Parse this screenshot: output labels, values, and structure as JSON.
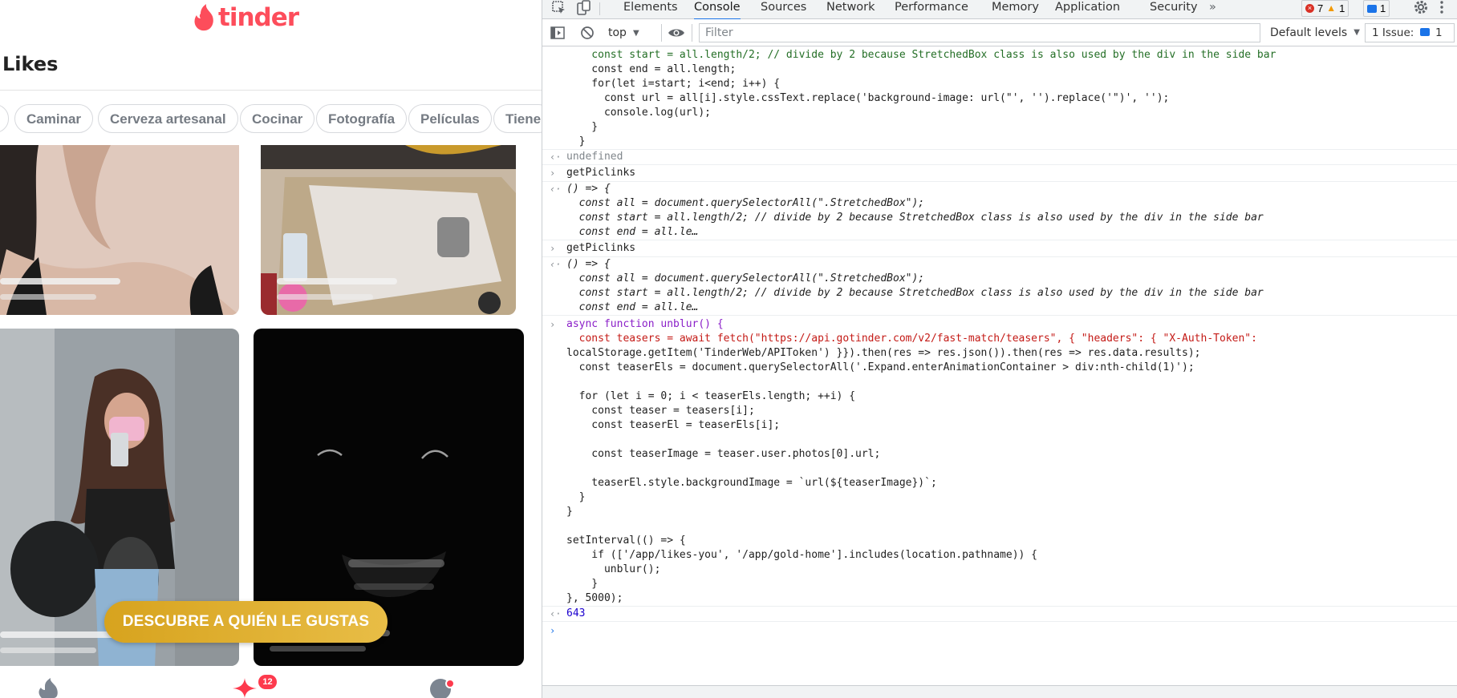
{
  "tinder": {
    "logo_text": "tinder",
    "page_title": "Likes",
    "interests": [
      "Caminar",
      "Cerveza artesanal",
      "Cocinar",
      "Fotografía",
      "Películas",
      "Tiene"
    ],
    "cta_label": "DESCUBRE A QUIÉN LE GUSTAS",
    "notification_count": "12",
    "brand_color": "#fd4d5b",
    "cta_color": "#e0ae30",
    "nav_icons": [
      "flame-icon",
      "sparkle-icon",
      "chat-icon"
    ]
  },
  "devtools": {
    "tabs": [
      "Elements",
      "Console",
      "Sources",
      "Network",
      "Performance",
      "Memory",
      "Application",
      "Security"
    ],
    "active_tab": "Console",
    "more_tabs": "»",
    "error_count": "7",
    "warning_count": "1",
    "message_count": "1",
    "context": "top",
    "filter_placeholder": "Filter",
    "levels": "Default levels",
    "issues_label": "1 Issue:",
    "issues_count": "1",
    "console_lines": {
      "l1": "    const start = all.length/2; // divide by 2 because StretchedBox class is also used by the div in the side bar",
      "l2": "    const end = all.length;",
      "l3": "    for(let i=start; i<end; i++) {",
      "l4": "      const url = all[i].style.cssText.replace('background-image: url(\"', '').replace('\")', '');",
      "l5": "      console.log(url);",
      "l6": "    }",
      "l7": "  }",
      "undefined": "undefined",
      "getpic": "getPiclinks",
      "arrow_fn": "() => {",
      "qs_all": "  const all = document.querySelectorAll(\".StretchedBox\");",
      "qs_start": "  const start = all.length/2; // divide by 2 because StretchedBox class is also used by the div in the side bar",
      "qs_end": "  const end = all.le…",
      "u1": "async function unblur() {",
      "u2": "  const teasers = await fetch(\"https://api.gotinder.com/v2/fast-match/teasers\", { \"headers\": { \"X-Auth-Token\":",
      "u3": "localStorage.getItem('TinderWeb/APIToken') }}).then(res => res.json()).then(res => res.data.results);",
      "u4": "  const teaserEls = document.querySelectorAll('.Expand.enterAnimationContainer > div:nth-child(1)');",
      "u5": "",
      "u6": "  for (let i = 0; i < teaserEls.length; ++i) {",
      "u7": "    const teaser = teasers[i];",
      "u8": "    const teaserEl = teaserEls[i];",
      "u9": "",
      "u10": "    const teaserImage = teaser.user.photos[0].url;",
      "u11": "",
      "u12": "    teaserEl.style.backgroundImage = `url(${teaserImage})`;",
      "u13": "  }",
      "u14": "}",
      "u15": "",
      "u16": "setInterval(() => {",
      "u17": "    if (['/app/likes-you', '/app/gold-home'].includes(location.pathname)) {",
      "u18": "      unblur();",
      "u19": "    }",
      "u20": "}, 5000);",
      "result": "643"
    }
  }
}
